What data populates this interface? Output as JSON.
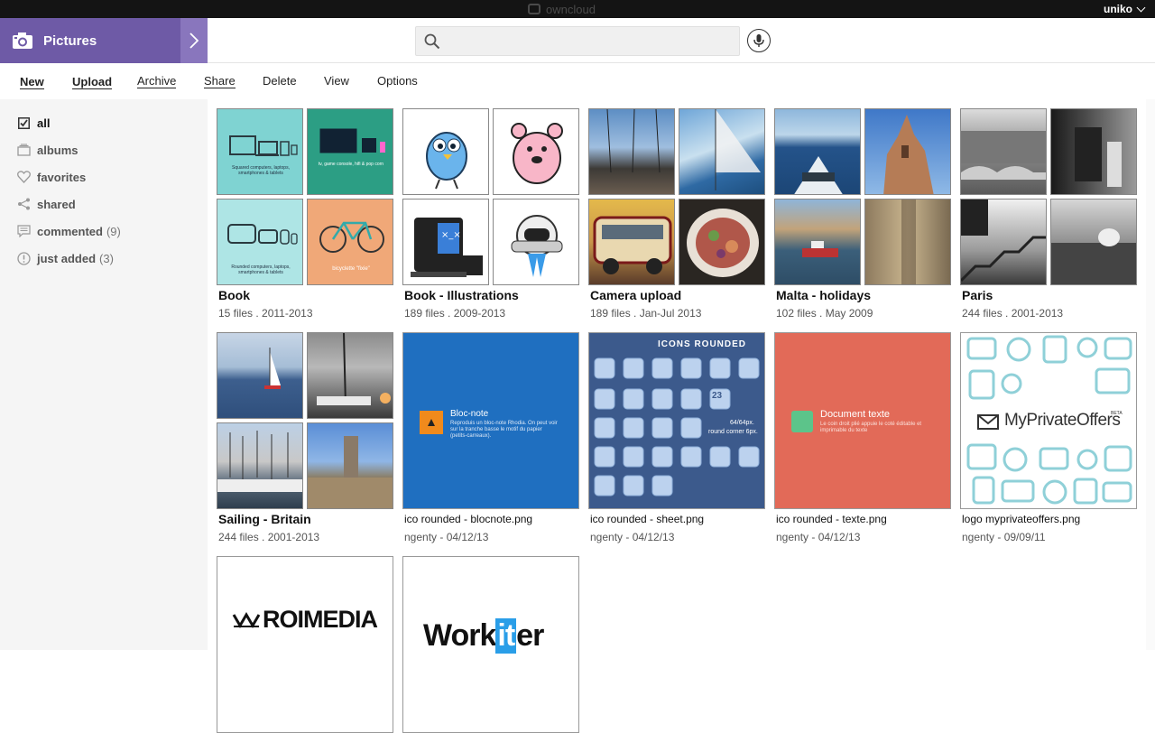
{
  "topbar": {
    "brand": "owncloud",
    "user": "uniko"
  },
  "header": {
    "app_name": "Pictures",
    "search_placeholder": ""
  },
  "toolbar": {
    "new": "New",
    "upload": "Upload",
    "archive": "Archive",
    "share": "Share",
    "delete": "Delete",
    "view": "View",
    "options": "Options"
  },
  "sidebar": {
    "items": [
      {
        "label": "all",
        "count": ""
      },
      {
        "label": "albums",
        "count": ""
      },
      {
        "label": "favorites",
        "count": ""
      },
      {
        "label": "shared",
        "count": ""
      },
      {
        "label": "commented",
        "count": "(9)"
      },
      {
        "label": "just added",
        "count": "(3)"
      }
    ]
  },
  "albums": [
    {
      "name": "Book",
      "meta": "15 files . 2011-2013"
    },
    {
      "name": "Book - Illustrations",
      "meta": "189 files . 2009-2013"
    },
    {
      "name": "Camera upload",
      "meta": "189 files . Jan-Jul 2013"
    },
    {
      "name": "Malta - holidays",
      "meta": "102 files . May 2009"
    },
    {
      "name": "Paris",
      "meta": "244 files . 2001-2013"
    },
    {
      "name": "Sailing - Britain",
      "meta": "244 files . 2001-2013"
    }
  ],
  "files": [
    {
      "name": "ico rounded - blocnote.png",
      "meta": "ngenty - 04/12/13",
      "title": "Bloc-note",
      "desc": "Reproduis un bloc-note Rhodia. On peut voir sur la tranche basse le motif du papier (petits-carreaux)."
    },
    {
      "name": "ico rounded - sheet.png",
      "meta": "ngenty - 04/12/13",
      "title": "ICONS ROUNDED",
      "desc1": "64/64px.",
      "desc2": "round corner 6px.",
      "day": "23"
    },
    {
      "name": "ico rounded - texte.png",
      "meta": "ngenty - 04/12/13",
      "title": "Document texte",
      "desc": "Le coin droit plié appuie le coté éditable et imprimable du texte"
    },
    {
      "name": "logo myprivateoffers.png",
      "meta": "ngenty - 09/09/11",
      "logo": "MyPrivateOffers",
      "badge": "BETA"
    },
    {
      "logo": "ROIMEDIA"
    },
    {
      "logo_a": "Work",
      "logo_b": "it",
      "logo_c": "er"
    }
  ],
  "book_thumbs": {
    "a": "Squared computers, laptops, smartphones & tablets",
    "b": "tv, game console, hifi & pop corn",
    "c": "Rounded computers, laptops, smartphones & tablets",
    "d": "bicyclette \"fixie\""
  },
  "colors": {
    "accent": "#6e5aa6",
    "accent_light": "#8976bd",
    "blue_tile": "#1f6fc0",
    "sheet_tile": "#3c5a8c",
    "red_tile": "#e26a58"
  }
}
